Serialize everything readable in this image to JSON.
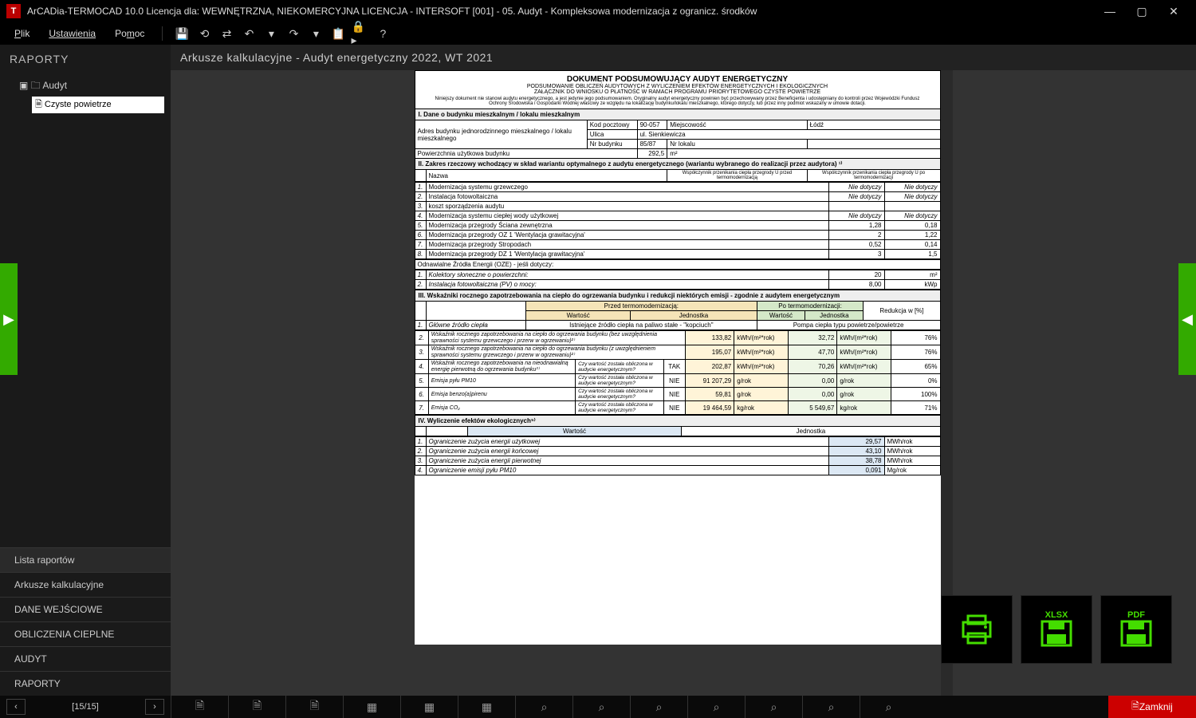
{
  "titlebar": {
    "app_icon": "T",
    "title": "ArCADia-TERMOCAD 10.0 Licencja dla: WEWNĘTRZNA, NIEKOMERCYJNA LICENCJA - INTERSOFT [001] - 05. Audyt - Kompleksowa modernizacja z ogranicz. środków",
    "min": "—",
    "max": "▢",
    "close": "✕"
  },
  "menu": {
    "file": "Plik",
    "settings": "Ustawienia",
    "help": "Pomoc"
  },
  "sidebar": {
    "header": "RAPORTY",
    "tree_root": "Audyt",
    "tree_leaf": "Czyste powietrze",
    "nav": {
      "lista": "Lista raportów",
      "arkusze": "Arkusze kalkulacyjne",
      "dane": "DANE WEJŚCIOWE",
      "oblicz": "OBLICZENIA CIEPLNE",
      "audyt": "AUDYT",
      "raporty": "RAPORTY"
    }
  },
  "docheader": "Arkusze kalkulacyjne - Audyt energetyczny 2022, WT 2021",
  "page": {
    "title": "DOKUMENT PODSUMOWUJĄCY AUDYT ENERGETYCZNY",
    "sub1": "PODSUMOWANIE OBLICZEŃ AUDYTOWYCH Z WYLICZENIEM EFEKTÓW ENERGETYCZNYCH I EKOLOGICZNYCH",
    "sub2": "ZAŁĄCZNIK DO WNIOSKU O PŁATNOŚĆ W RAMACH PROGRAMU PRIORYTETOWEGO CZYSTE POWIETRZE",
    "disc": "Niniejszy dokument nie stanowi audytu energetycznego, a jest jedynie jego podsumowaniem. Oryginalny audyt energetyczny powinien być przechowywany przez Beneficjenta i udostępniany do kontroli przez Wojewódzki Fundusz Ochrony Środowiska i Gospodarki Wodnej właściwy ze względu na lokalizację budynku/lokalu mieszkalnego, którego dotyczy, lub przez inny podmiot wskazany w umowie dotacji.",
    "sec1": {
      "header": "I. Dane o budynku mieszkalnym / lokalu mieszkalnym",
      "address_label": "Adres budynku jednorodzinnego mieszkalnego / lokalu mieszkalnego",
      "kod_l": "Kod pocztowy",
      "kod_v": "90-057",
      "miej_l": "Miejscowość",
      "miej_v": "Łódź",
      "ulica_l": "Ulica",
      "ulica_v": "ul. Sienkiewicza",
      "nrb_l": "Nr budynku",
      "nrb_v": "85/87",
      "nrl_l": "Nr lokalu",
      "nrl_v": "",
      "pow_l": "Powierzchnia użytkowa budynku",
      "pow_v": "292,5",
      "pow_u": "m²"
    },
    "sec2": {
      "header": "II. Zakres rzeczowy wchodzący w skład wariantu optymalnego z audytu energetycznego (wariantu wybranego do realizacji przez audytora) ¹⁾",
      "col_name": "Nazwa",
      "col_u_pre": "Współczynnik przenikania ciepła przegrody U przed termomodernizacją",
      "col_u_post": "Współczynnik przenikania ciepła przegrody U po termomodernizacji",
      "rows": [
        {
          "n": "1.",
          "name": "Modernizacja systemu grzewczego",
          "pre": "Nie dotyczy",
          "post": "Nie dotyczy"
        },
        {
          "n": "2.",
          "name": "Instalacja fotowoltaiczna",
          "pre": "Nie dotyczy",
          "post": "Nie dotyczy"
        },
        {
          "n": "3.",
          "name": "koszt sporządzenia audytu",
          "pre": "",
          "post": ""
        },
        {
          "n": "4.",
          "name": "Modernizacja systemu ciepłej wody użytkowej",
          "pre": "Nie dotyczy",
          "post": "Nie dotyczy"
        },
        {
          "n": "5.",
          "name": "Modernizacja przegrody Ściana zewnętrzna",
          "pre": "1,28",
          "post": "0,18"
        },
        {
          "n": "6.",
          "name": "Modernizacja przegrody OZ 1 'Wentylacja grawitacyjna'",
          "pre": "2",
          "post": "1,22"
        },
        {
          "n": "7.",
          "name": "Modernizacja przegrody Stropodach",
          "pre": "0,52",
          "post": "0,14"
        },
        {
          "n": "8.",
          "name": "Modernizacja przegrody DZ 1 'Wentylacja grawitacyjna'",
          "pre": "3",
          "post": "1,5"
        }
      ],
      "oze_header": "Odnawialne Źródła Energii (OZE) - jeśli dotyczy:",
      "oze_rows": [
        {
          "n": "1.",
          "name": "Kolektory słoneczne o powierzchni:",
          "v": "20",
          "u": "m²"
        },
        {
          "n": "2.",
          "name": "Instalacja fotowoltaiczna (PV) o mocy:",
          "v": "8,00",
          "u": "kWp"
        }
      ]
    },
    "sec3": {
      "header": "III. Wskaźniki rocznego zapotrzebowania na ciepło do ogrzewania budynku i redukcji niektórych emisji - zgodnie z audytem energetycznym",
      "pre_h": "Przed termomodernizacją:",
      "post_h": "Po termomodernizacji:",
      "red_h": "Redukcja w [%]",
      "val_h": "Wartość",
      "unit_h": "Jednostka",
      "row1": {
        "n": "1.",
        "name": "Główne źródło ciepła",
        "pre": "Istniejące źródło ciepła na paliwo stałe - \"kopciuch\"",
        "post": "Pompa ciepła typu powietrze/powietrze"
      },
      "rows": [
        {
          "n": "2.",
          "name": "Wskaźnik rocznego zapotrzebowania na ciepło do ogrzewania budynku (bez uwzględnienia sprawności systemu grzewczego i przerw w ogrzewaniu)²⁾",
          "ask": "",
          "flag": "",
          "pv": "133,82",
          "pu": "kWh/(m²*rok)",
          "av": "32,72",
          "au": "kWh/(m²*rok)",
          "r": "76%"
        },
        {
          "n": "3.",
          "name": "Wskaźnik rocznego zapotrzebowania na ciepło do ogrzewania budynku (z uwzględnieniem sprawności systemu grzewczego i przerw w ogrzewaniu)²⁾",
          "ask": "",
          "flag": "",
          "pv": "195,07",
          "pu": "kWh/(m²*rok)",
          "av": "47,70",
          "au": "kWh/(m²*rok)",
          "r": "76%"
        },
        {
          "n": "4.",
          "name": "Wskaźnik rocznego zapotrzebowania na nieodnawialną energię pierwotną do ogrzewania budynku³⁾",
          "ask": "Czy wartość została obliczona w audycie energetycznym?",
          "flag": "TAK",
          "pv": "202,87",
          "pu": "kWh/(m²*rok)",
          "av": "70,26",
          "au": "kWh/(m²*rok)",
          "r": "65%"
        },
        {
          "n": "5.",
          "name": "Emisja pyłu PM10",
          "ask": "Czy wartość została obliczona w audycie energetycznym?",
          "flag": "NIE",
          "pv": "91 207,29",
          "pu": "g/rok",
          "av": "0,00",
          "au": "g/rok",
          "r": "0%"
        },
        {
          "n": "6.",
          "name": "Emisja benzo(a)pirenu",
          "ask": "Czy wartość została obliczona w audycie energetycznym?",
          "flag": "NIE",
          "pv": "59,81",
          "pu": "g/rok",
          "av": "0,00",
          "au": "g/rok",
          "r": "100%"
        },
        {
          "n": "7.",
          "name": "Emisja CO₂",
          "ask": "Czy wartość została obliczona w audycie energetycznym?",
          "flag": "NIE",
          "pv": "19 464,59",
          "pu": "kg/rok",
          "av": "5 549,67",
          "au": "kg/rok",
          "r": "71%"
        }
      ]
    },
    "sec4": {
      "header": "IV. Wyliczenie efektów ekologicznych⁵⁾",
      "val_h": "Wartość",
      "unit_h": "Jednostka",
      "rows": [
        {
          "n": "1.",
          "name": "Ograniczenie zużycia energii użytkowej",
          "v": "29,57",
          "u": "MWh/rok"
        },
        {
          "n": "2.",
          "name": "Ograniczenie zużycia energii końcowej",
          "v": "43,10",
          "u": "MWh/rok"
        },
        {
          "n": "3.",
          "name": "Ograniczenie zużycia energii pierwotnej",
          "v": "38,78",
          "u": "MWh/rok"
        },
        {
          "n": "4.",
          "name": "Ograniczenie emisji pyłu PM10",
          "v": "0,091",
          "u": "Mg/rok"
        }
      ]
    }
  },
  "bigbtns": {
    "xlsx": "XLSX",
    "pdf": "PDF"
  },
  "footer": {
    "page": "[15/15]",
    "close": "Zamknij"
  }
}
